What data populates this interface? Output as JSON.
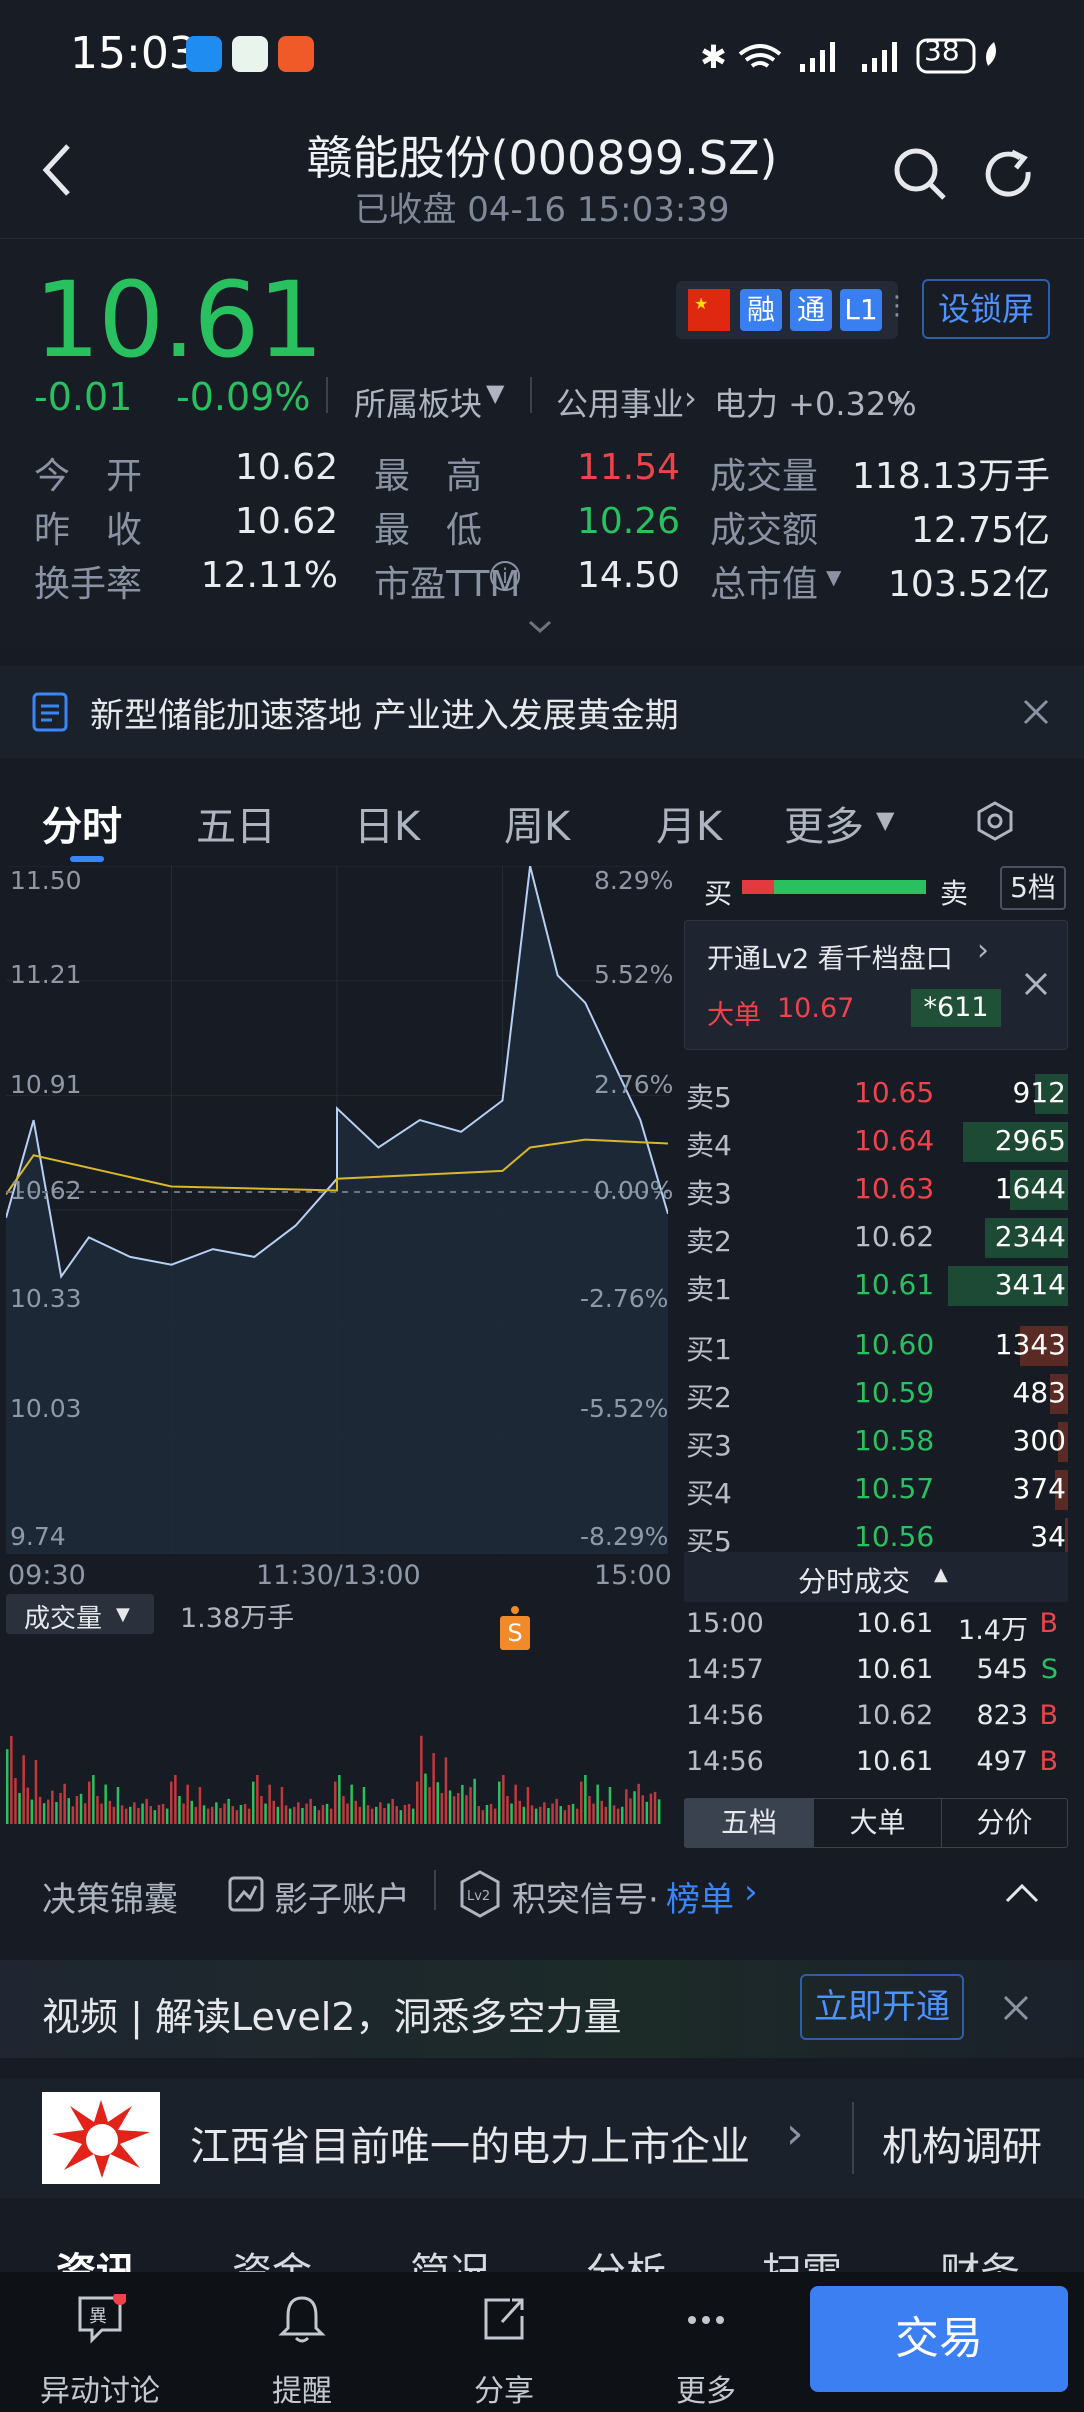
{
  "status_bar": {
    "time": "15:03",
    "battery": "38"
  },
  "header": {
    "title": "赣能股份(000899.SZ)",
    "subtitle": "已收盘 04-16 15:03:39"
  },
  "quote": {
    "price": "10.61",
    "change": "-0.01",
    "change_pct": "-0.09%",
    "sector_label": "所属板块",
    "sector1": "公用事业",
    "sector2": "电力 +0.32%",
    "tags": [
      "融",
      "通",
      "L1"
    ],
    "lock_button": "设锁屏",
    "stats": [
      {
        "label": "今　开",
        "value": "10.62",
        "label2": "最　高",
        "value2": "11.54",
        "label3": "成交量",
        "value3": "118.13万手"
      },
      {
        "label": "昨　收",
        "value": "10.62",
        "label2": "最　低",
        "value2": "10.26",
        "label3": "成交额",
        "value3": "12.75亿"
      },
      {
        "label": "换手率",
        "value": "12.11%",
        "label2": "市盈TTM",
        "value2": "14.50",
        "label3": "总市值",
        "value3": "103.52亿"
      }
    ]
  },
  "news": {
    "text": "新型储能加速落地 产业进入发展黄金期"
  },
  "tabs": [
    "分时",
    "五日",
    "日K",
    "周K",
    "月K",
    "更多"
  ],
  "chart": {
    "y_left": [
      "11.50",
      "11.21",
      "10.91",
      "10.62",
      "10.33",
      "10.03",
      "9.74"
    ],
    "y_right": [
      "8.29%",
      "5.52%",
      "2.76%",
      "0.00%",
      "-2.76%",
      "-5.52%",
      "-8.29%"
    ],
    "x_labels": [
      "09:30",
      "11:30/13:00",
      "15:00"
    ],
    "marker": "S",
    "volume_label": "成交量",
    "volume_value": "1.38万手"
  },
  "chart_data": {
    "type": "line",
    "title": "",
    "xlabel": "",
    "ylabel": "",
    "ylim": [
      9.74,
      11.5
    ],
    "x_ticks": [
      "09:30",
      "11:30/13:00",
      "15:00"
    ],
    "series": [
      {
        "name": "",
        "x": [
          "09:30",
          "09:40",
          "09:50",
          "10:00",
          "10:15",
          "10:30",
          "10:45",
          "11:00",
          "11:15",
          "11:30",
          "13:00",
          "13:15",
          "13:30",
          "13:45",
          "14:00",
          "14:10",
          "14:20",
          "14:30",
          "14:40",
          "14:50",
          "15:00"
        ],
        "values": [
          10.6,
          10.85,
          10.45,
          10.55,
          10.5,
          10.48,
          10.52,
          10.5,
          10.58,
          10.7,
          10.88,
          10.78,
          10.85,
          10.82,
          10.9,
          11.5,
          11.22,
          11.15,
          11.0,
          10.85,
          10.61
        ]
      },
      {
        "name": "",
        "x": [
          "09:30",
          "09:40",
          "10:30",
          "11:30",
          "13:00",
          "14:00",
          "14:10",
          "14:30",
          "15:00"
        ],
        "values": [
          10.66,
          10.76,
          10.68,
          10.67,
          10.7,
          10.72,
          10.78,
          10.8,
          10.79
        ]
      }
    ]
  },
  "orderbook": {
    "header_buy": "买",
    "header_sell": "卖",
    "depth_button": "5档",
    "promo_title": "开通Lv2 看千档盘口",
    "promo_big_label": "大单",
    "promo_big_price": "10.67",
    "promo_big_qty": "*611",
    "sells": [
      {
        "label": "卖5",
        "price": "10.65",
        "qty": "912",
        "share": 0.13
      },
      {
        "label": "卖4",
        "price": "10.64",
        "qty": "2965",
        "share": 0.42
      },
      {
        "label": "卖3",
        "price": "10.63",
        "qty": "1644",
        "share": 0.23
      },
      {
        "label": "卖2",
        "price": "10.62",
        "qty": "2344",
        "share": 0.33
      },
      {
        "label": "卖1",
        "price": "10.61",
        "qty": "3414",
        "share": 0.48
      }
    ],
    "buys": [
      {
        "label": "买1",
        "price": "10.60",
        "qty": "1343",
        "share": 0.19
      },
      {
        "label": "买2",
        "price": "10.59",
        "qty": "483",
        "share": 0.07
      },
      {
        "label": "买3",
        "price": "10.58",
        "qty": "300",
        "share": 0.04
      },
      {
        "label": "买4",
        "price": "10.57",
        "qty": "374",
        "share": 0.05
      },
      {
        "label": "买5",
        "price": "10.56",
        "qty": "34",
        "share": 0.01
      }
    ],
    "ticks_title": "分时成交",
    "ticks": [
      {
        "time": "15:00",
        "price": "10.61",
        "qty": "1.4万",
        "side": "B"
      },
      {
        "time": "14:57",
        "price": "10.61",
        "qty": "545",
        "side": "S"
      },
      {
        "time": "14:56",
        "price": "10.62",
        "qty": "823",
        "side": "B"
      },
      {
        "time": "14:56",
        "price": "10.61",
        "qty": "497",
        "side": "B"
      }
    ],
    "bottom_tabs": [
      "五档",
      "大单",
      "分价"
    ]
  },
  "tools": {
    "t1": "决策锦囊",
    "t2": "影子账户",
    "t3": "积突信号·",
    "t4": "榜单"
  },
  "video": {
    "text": "视频 | 解读Level2，洞悉多空力量",
    "button": "立即开通"
  },
  "company": {
    "text": "江西省目前唯一的电力上市企业",
    "right": "机构调研"
  },
  "section_tabs": [
    "资讯",
    "资金",
    "简况",
    "分析",
    "扫雷",
    "财务"
  ],
  "nav": {
    "items": [
      "异动讨论",
      "提醒",
      "分享",
      "更多"
    ],
    "trade": "交易"
  }
}
